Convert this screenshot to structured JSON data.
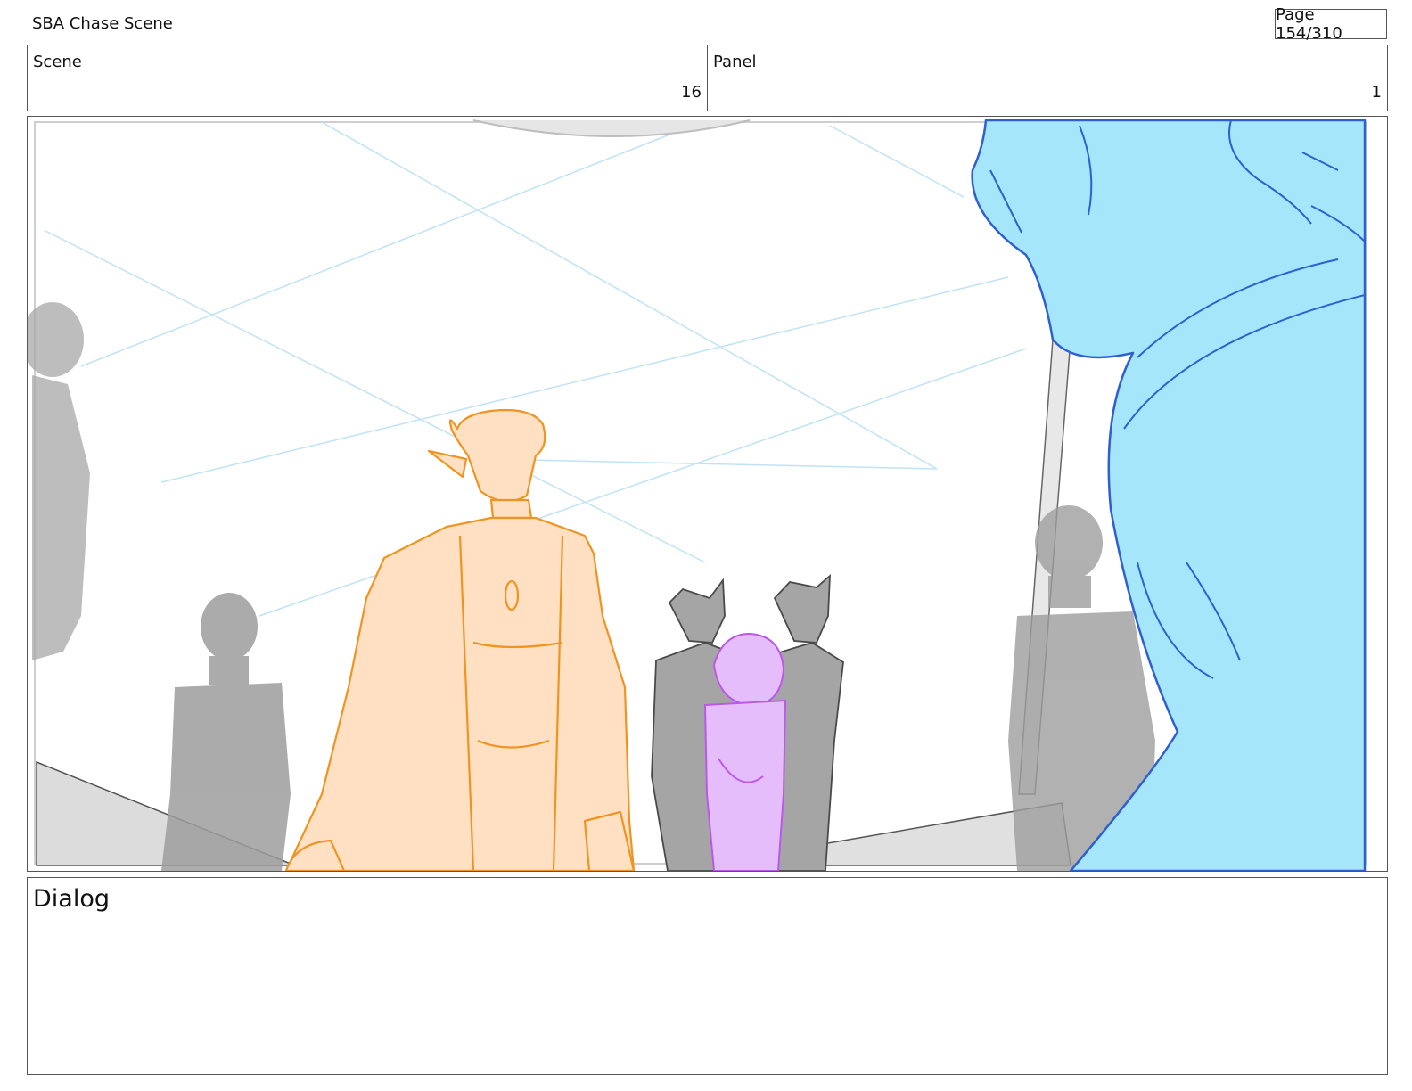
{
  "header": {
    "title": "SBA Chase Scene",
    "page": "Page 154/310"
  },
  "info": {
    "scene_label": "Scene",
    "scene_value": "16",
    "panel_label": "Panel",
    "panel_value": "1"
  },
  "dialog": {
    "label": "Dialog"
  },
  "colors": {
    "orange_fill": "#ffe0c2",
    "orange_line": "#ef9422",
    "purple_fill": "#e5bdfb",
    "purple_line": "#bb58ec",
    "blue_fill": "#a6e6fa",
    "blue_line": "#2f5fd0",
    "grey_fill": "#9d9d9d",
    "guide_line": "#bfe3f5"
  }
}
